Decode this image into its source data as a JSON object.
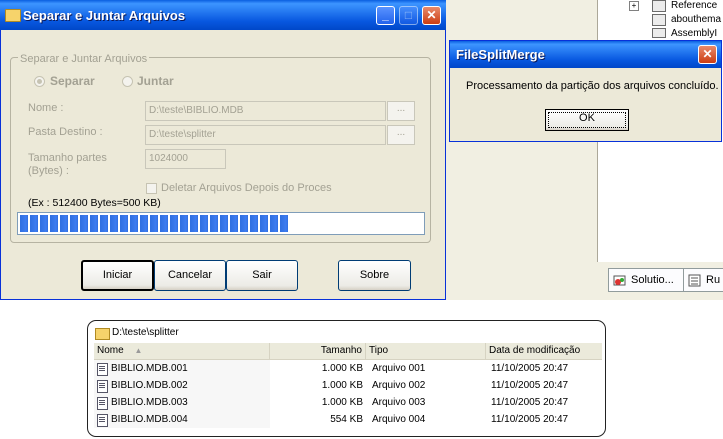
{
  "ide": {
    "tree_items": [
      "Reference",
      "abouthema",
      "AssemblyI"
    ],
    "tabs": [
      "Solutio...",
      "Ru"
    ]
  },
  "dialog": {
    "title": "Separar e Juntar Arquivos",
    "group_label": "Separar e Juntar Arquivos",
    "radio_separar": "Separar",
    "radio_juntar": "Juntar",
    "nome_label": "Nome :",
    "nome_value": "D:\\teste\\BIBLIO.MDB",
    "pasta_label": "Pasta Destino  :",
    "pasta_value": "D:\\teste\\splitter",
    "tamanho_label_1": "Tamanho partes",
    "tamanho_label_2": "(Bytes) :",
    "tamanho_value": "1024000",
    "browse_label": "...",
    "deletar_label": "Deletar  Arquivos  Depois  do Proces",
    "exemplo": "(Ex : 512400 Bytes=500 KB)",
    "progress_fraction": 0.67,
    "buttons": {
      "iniciar": "Iniciar",
      "cancelar": "Cancelar",
      "sair": "Sair",
      "sobre": "Sobre"
    }
  },
  "message_box": {
    "title": "FileSplitMerge",
    "text": "Processamento da partição dos arquivos concluído.",
    "ok": "OK"
  },
  "explorer": {
    "path": "D:\\teste\\splitter",
    "columns": [
      "Nome",
      "Tamanho",
      "Tipo",
      "Data de modificação"
    ],
    "files": [
      {
        "name": "BIBLIO.MDB.001",
        "size": "1.000 KB",
        "type": "Arquivo 001",
        "date": "11/10/2005 20:47"
      },
      {
        "name": "BIBLIO.MDB.002",
        "size": "1.000 KB",
        "type": "Arquivo 002",
        "date": "11/10/2005 20:47"
      },
      {
        "name": "BIBLIO.MDB.003",
        "size": "1.000 KB",
        "type": "Arquivo 003",
        "date": "11/10/2005 20:47"
      },
      {
        "name": "BIBLIO.MDB.004",
        "size": "554 KB",
        "type": "Arquivo 004",
        "date": "11/10/2005 20:47"
      }
    ]
  },
  "colors": {
    "titlebar": "#0858e0",
    "window_bg": "#ece9d8",
    "progress_blue": "#2f6fe0",
    "disabled_text": "#a3a193"
  }
}
